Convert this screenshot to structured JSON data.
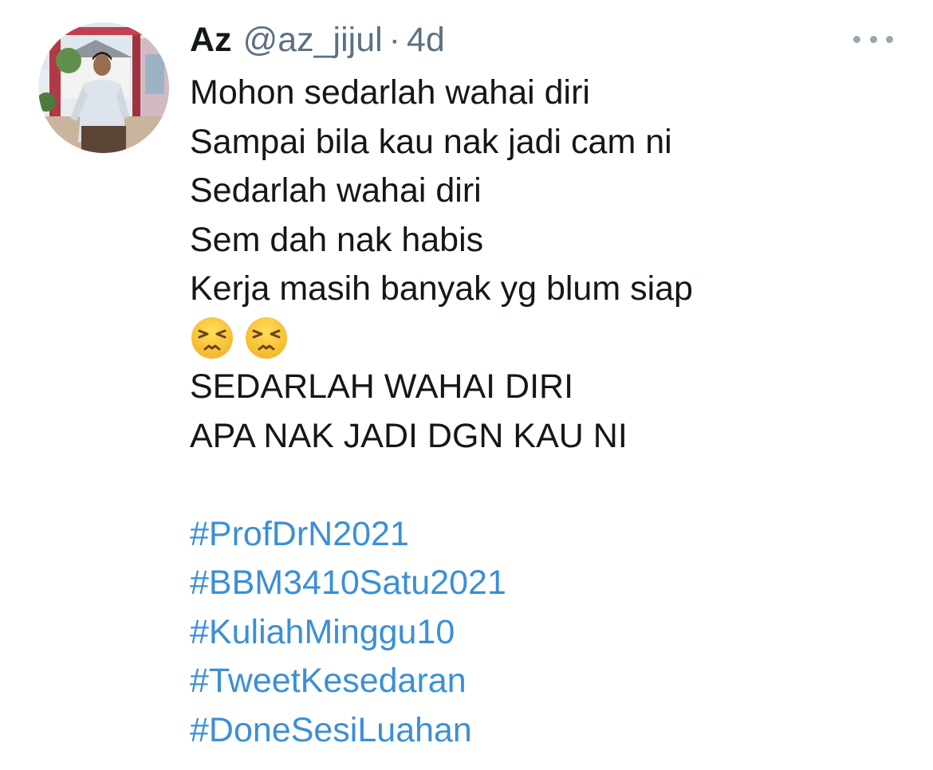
{
  "tweet": {
    "author": {
      "display_name": "Az",
      "handle": "@az_jijul"
    },
    "separator": "·",
    "timestamp": "4d",
    "more_icon": "more-horizontal-icon",
    "lines": [
      "Mohon sedarlah wahai diri",
      "Sampai bila kau nak jadi cam ni",
      "Sedarlah wahai diri",
      "Sem dah nak habis",
      "Kerja masih banyak yg blum siap"
    ],
    "emojis": [
      "persevering-face-emoji",
      "persevering-face-emoji"
    ],
    "caps_lines": [
      "SEDARLAH WAHAI DIRI",
      "APA NAK JADI DGN KAU NI"
    ],
    "hashtags": [
      "#ProfDrN2021",
      "#BBM3410Satu2021",
      "#KuliahMinggu10",
      "#TweetKesedaran",
      "#DoneSesiLuahan"
    ],
    "colors": {
      "text": "#14171a",
      "secondary": "#5b7083",
      "link": "#3b8fd6",
      "icon": "#9aa7b3"
    }
  }
}
